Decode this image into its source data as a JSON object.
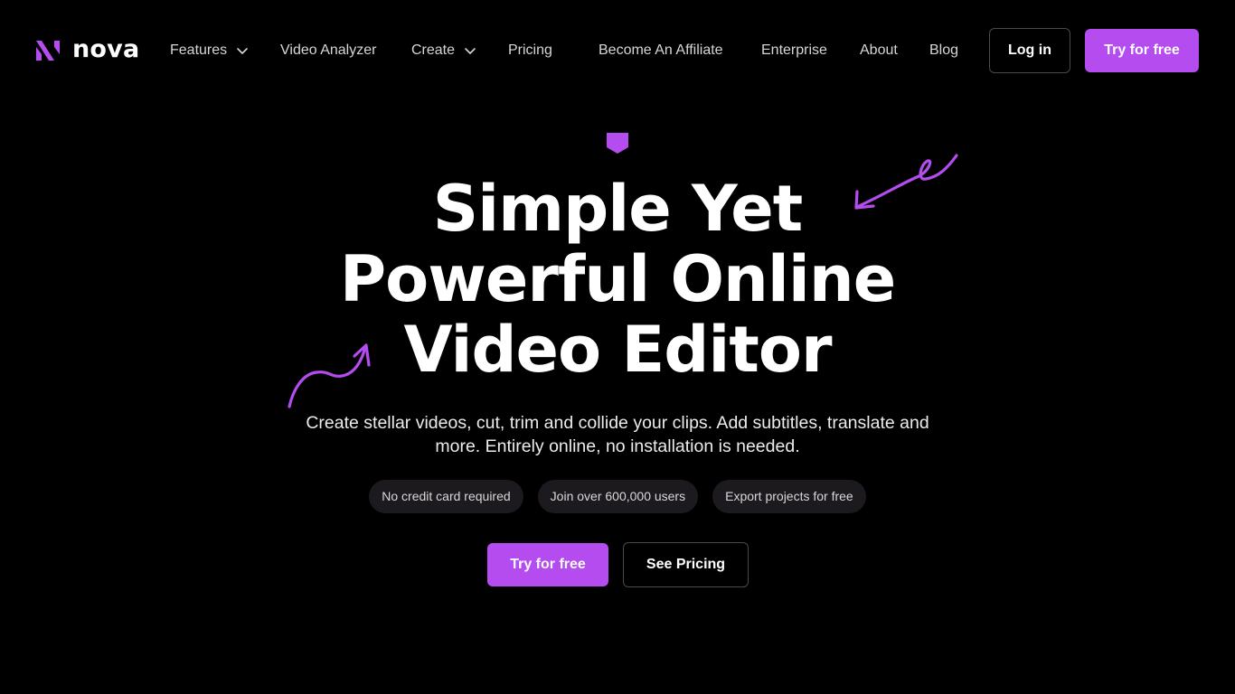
{
  "brand": {
    "name": "nova",
    "accent_color": "#b44cf0",
    "background_color": "#000000"
  },
  "nav": {
    "items": [
      {
        "label": "Features",
        "has_dropdown": true
      },
      {
        "label": "Video Analyzer",
        "has_dropdown": false
      },
      {
        "label": "Create",
        "has_dropdown": true
      },
      {
        "label": "Pricing",
        "has_dropdown": false
      },
      {
        "label": "Become An Affiliate",
        "has_dropdown": false
      },
      {
        "label": "Enterprise",
        "has_dropdown": false
      },
      {
        "label": "About",
        "has_dropdown": false
      },
      {
        "label": "Blog",
        "has_dropdown": false
      }
    ],
    "login_label": "Log in",
    "try_label": "Try for free",
    "dropdown_icon": "chevron-down-icon"
  },
  "hero": {
    "title_lines": [
      "Simple Yet",
      "Powerful Online",
      "Video Editor"
    ],
    "subtitle": "Create stellar videos, cut, trim and collide your clips. Add subtitles, translate and more. Entirely online, no installation is needed.",
    "pills": [
      "No credit card required",
      "Join over 600,000 users",
      "Export projects for free"
    ],
    "primary_cta": "Try for free",
    "secondary_cta": "See Pricing",
    "decorations": [
      "badge-icon",
      "curved-arrow-icon"
    ]
  }
}
